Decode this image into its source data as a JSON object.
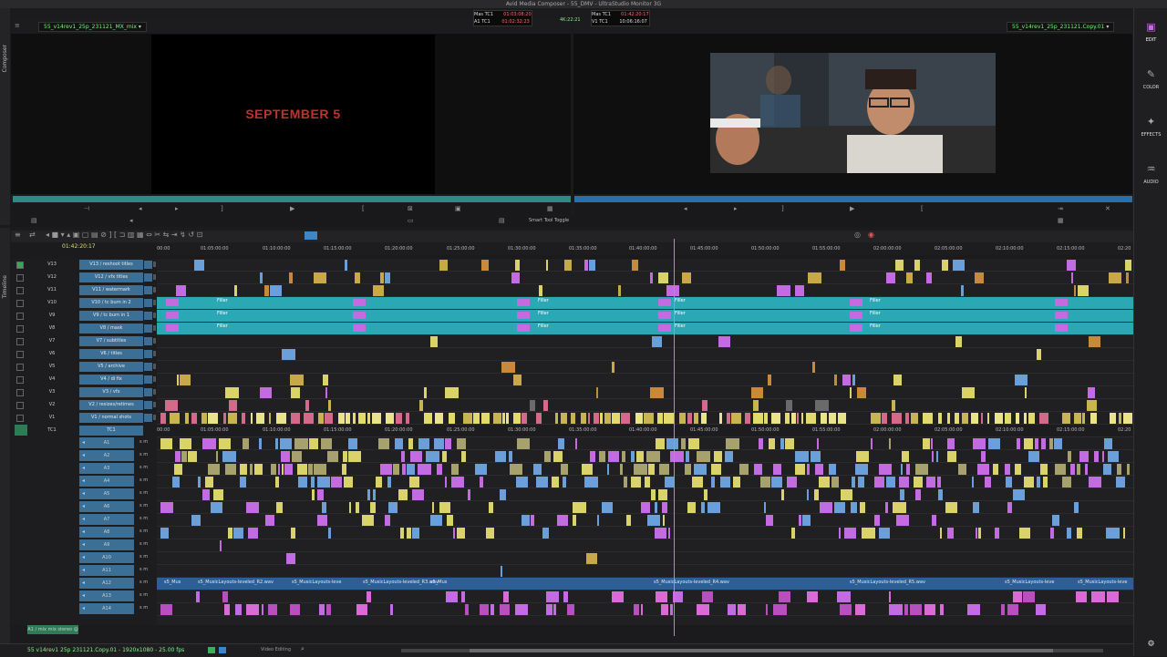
{
  "window": {
    "title": "Avid Media Composer - 55_DMV - UltraStudio Monitor 3G"
  },
  "left_strip": {
    "composer_label": "Composer",
    "timeline_label": "Timeline"
  },
  "source_monitor": {
    "clip_name": "55_v14rev1_25p_231121_MX_mix",
    "frame_title": "SEPTEMBER 5"
  },
  "record_monitor": {
    "clip_name": "55_v14rev1_25p_231121.Copy.01"
  },
  "timecode_center": {
    "src_line1_label": "Mas TC1",
    "src_line1_value": "01:03:08:20",
    "src_line2_label": "A1 TC1",
    "src_line2_value": "01:02:32:23",
    "middle_value": "4K:22:21",
    "rec_line1_label": "Mas TC1",
    "rec_line1_value": "01:42:20:17",
    "rec_line2_label": "V1 TC1",
    "rec_line2_value": "10:06:16:07"
  },
  "toolbar": {
    "smart_tool_label": "Smart Tool Toggle"
  },
  "timeline": {
    "master_timecode": "01:42:20:17",
    "ruler": [
      "00:00",
      "01:05:00:00",
      "01:10:00:00",
      "01:15:00:00",
      "01:20:00:00",
      "01:25:00:00",
      "01:30:00:00",
      "01:35:00:00",
      "01:40:00:00",
      "01:45:00:00",
      "01:50:00:00",
      "01:55:00:00",
      "02:00:00:00",
      "02:05:00:00",
      "02:10:00:00",
      "02:15:00:00",
      "02:20"
    ],
    "video_tracks": [
      {
        "num": "V13",
        "name": "V13 / reshoot titles"
      },
      {
        "num": "V12",
        "name": "V12 / vfx titles"
      },
      {
        "num": "V11",
        "name": "V11 / watermark"
      },
      {
        "num": "V10",
        "name": "V10 / tc burn in 2"
      },
      {
        "num": "V9",
        "name": "V9 / tc burn in 1"
      },
      {
        "num": "V8",
        "name": "V8 / mask"
      },
      {
        "num": "V7",
        "name": "V7 / subtitles"
      },
      {
        "num": "V6",
        "name": "V6 / titles"
      },
      {
        "num": "V5",
        "name": "V5 / archive"
      },
      {
        "num": "V4",
        "name": "V4 / di fix"
      },
      {
        "num": "V3",
        "name": "V3 / vfx"
      },
      {
        "num": "V2",
        "name": "V2 / resizes/retimes"
      },
      {
        "num": "V1",
        "name": "V1 / normal shots"
      }
    ],
    "timecode_track": {
      "num": "TC1",
      "name": "TC1"
    },
    "audio_tracks": [
      "A1",
      "A2",
      "A3",
      "A4",
      "A5",
      "A6",
      "A7",
      "A8",
      "A9",
      "A10",
      "A11",
      "A12",
      "A13",
      "A14"
    ],
    "filler_label": "Filler",
    "music_clips": [
      "s5_Mus",
      "s5_MusicLayouts-leveled_R2.wav",
      "s5_MusicLayouts-leve",
      "s5_MusicLayouts-leveled_R3.wav",
      "s5_MusicLayouts-leveled_R4.wav",
      "s5_MusicLayouts-leveled_R5.wav",
      "s5_MusicLayouts-leve"
    ],
    "a1_mix_label": "A1 / mix mix stereo @"
  },
  "right_panel": {
    "items": [
      "EDIT",
      "COLOR",
      "EFFECTS",
      "AUDIO"
    ]
  },
  "status_bar": {
    "sequence_info": "55 v14rev1 25p 231121.Copy.01 - 1920x1080 - 25.00 fps",
    "mode_label": "Video Editing"
  }
}
